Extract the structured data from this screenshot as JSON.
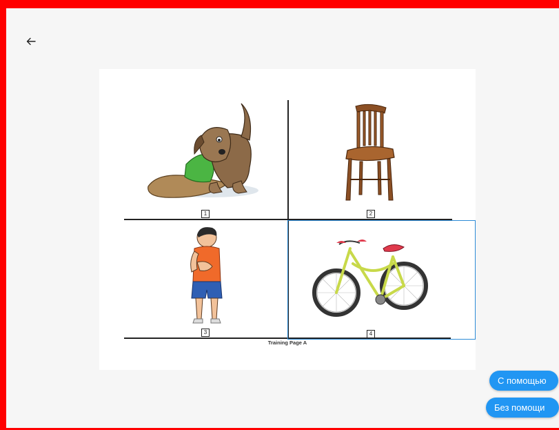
{
  "nav": {
    "back_icon": "arrow-left-icon"
  },
  "training_page": {
    "caption": "Training Page A",
    "cells": [
      {
        "number": "1",
        "picture": "dog-chewing-shoe"
      },
      {
        "number": "2",
        "picture": "wooden-chair"
      },
      {
        "number": "3",
        "picture": "boy-with-hands-on-chest"
      },
      {
        "number": "4",
        "picture": "bicycle"
      }
    ],
    "selected_cell": "4",
    "selection_color": "#2b8ad6"
  },
  "actions": {
    "with_help_label": "С помощью",
    "without_help_label": "Без помощи",
    "button_color": "#2196f3"
  },
  "frame_color": "#ff0000"
}
